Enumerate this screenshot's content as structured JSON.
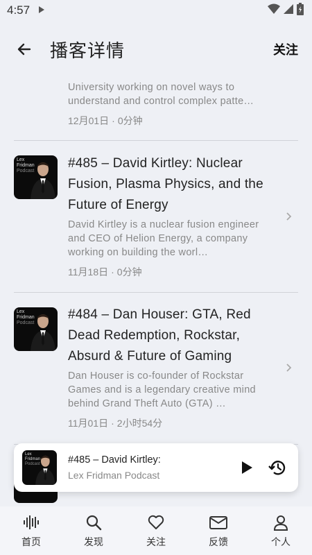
{
  "status": {
    "time": "4:57"
  },
  "header": {
    "title": "播客详情",
    "follow_label": "关注"
  },
  "episodes": [
    {
      "title": "",
      "description": "University working on novel ways to understand and control complex patte…",
      "date": "12月01日",
      "duration": "0分钟"
    },
    {
      "title": "#485 – David Kirtley: Nuclear Fusion, Plasma Physics, and the Future of Energy",
      "description": "David Kirtley is a nuclear fusion engineer and CEO of Helion Energy, a company working on building the worl…",
      "date": "11月18日",
      "duration": "0分钟"
    },
    {
      "title": "#484 – Dan Houser: GTA, Red Dead Redemption, Rockstar, Absurd & Future of Gaming",
      "description": "Dan Houser is co-founder of Rockstar Games and is a legendary creative mind behind Grand Theft Auto (GTA) …",
      "date": "11月01日",
      "duration": "2小时54分"
    }
  ],
  "thumb": {
    "line1": "Lex",
    "line2": "Fridman",
    "line3": "Podcast"
  },
  "player": {
    "title": "#485 – David Kirtley:",
    "subtitle": "Lex Fridman Podcast"
  },
  "nav": [
    {
      "label": "首页",
      "icon": "waveform-icon"
    },
    {
      "label": "发现",
      "icon": "search-icon"
    },
    {
      "label": "关注",
      "icon": "heart-icon"
    },
    {
      "label": "反馈",
      "icon": "mail-icon"
    },
    {
      "label": "个人",
      "icon": "person-icon"
    }
  ]
}
